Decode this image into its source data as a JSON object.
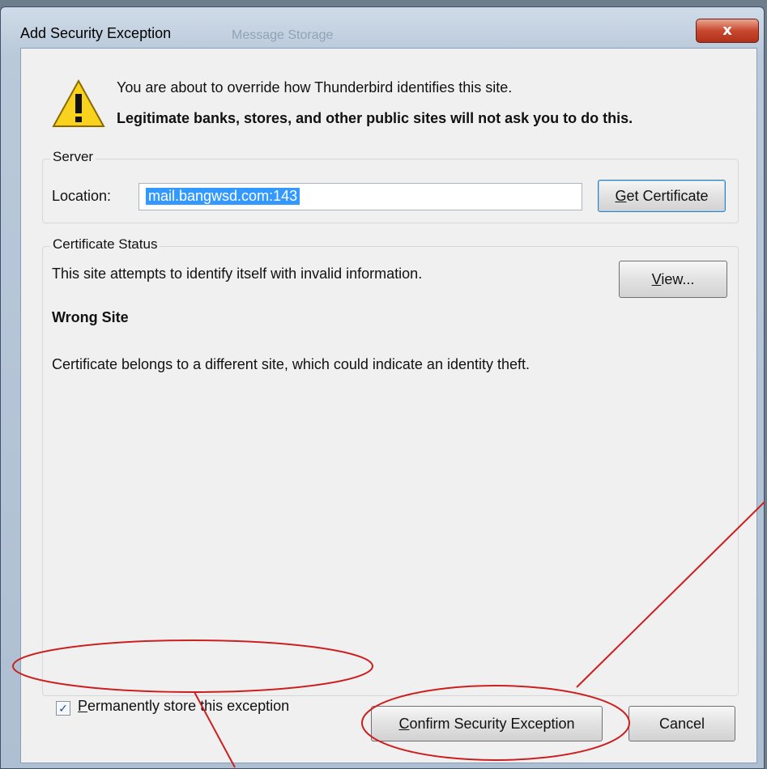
{
  "window": {
    "title": "Add Security Exception",
    "ghost_title": "Message Storage",
    "close_glyph": "x"
  },
  "warning": {
    "line1": "You are about to override how Thunderbird identifies this site.",
    "line2": "Legitimate banks, stores, and other public sites will not ask you to do this."
  },
  "server": {
    "group_label": "Server",
    "location_label": "Location:",
    "location_value": "mail.bangwsd.com:143",
    "get_cert_mnemonic": "G",
    "get_cert_rest": "et Certificate"
  },
  "status": {
    "group_label": "Certificate Status",
    "line1": "This site attempts to identify itself with invalid information.",
    "view_mnemonic": "V",
    "view_rest": "iew...",
    "wrong_site": "Wrong Site",
    "detail": "Certificate belongs to a different site, which could indicate an identity theft."
  },
  "permanent": {
    "checked": true,
    "check_glyph": "✓",
    "mnemonic": "P",
    "rest": "ermanently store this exception"
  },
  "buttons": {
    "confirm_mnemonic": "C",
    "confirm_rest": "onfirm Security Exception",
    "cancel": "Cancel"
  },
  "colors": {
    "annotation": "#cc1f1f",
    "selection": "#3399ff",
    "title_close": "#c8482f"
  },
  "icons": {
    "warning": "warning-triangle-icon",
    "close": "close-icon",
    "check": "checkmark-icon"
  }
}
